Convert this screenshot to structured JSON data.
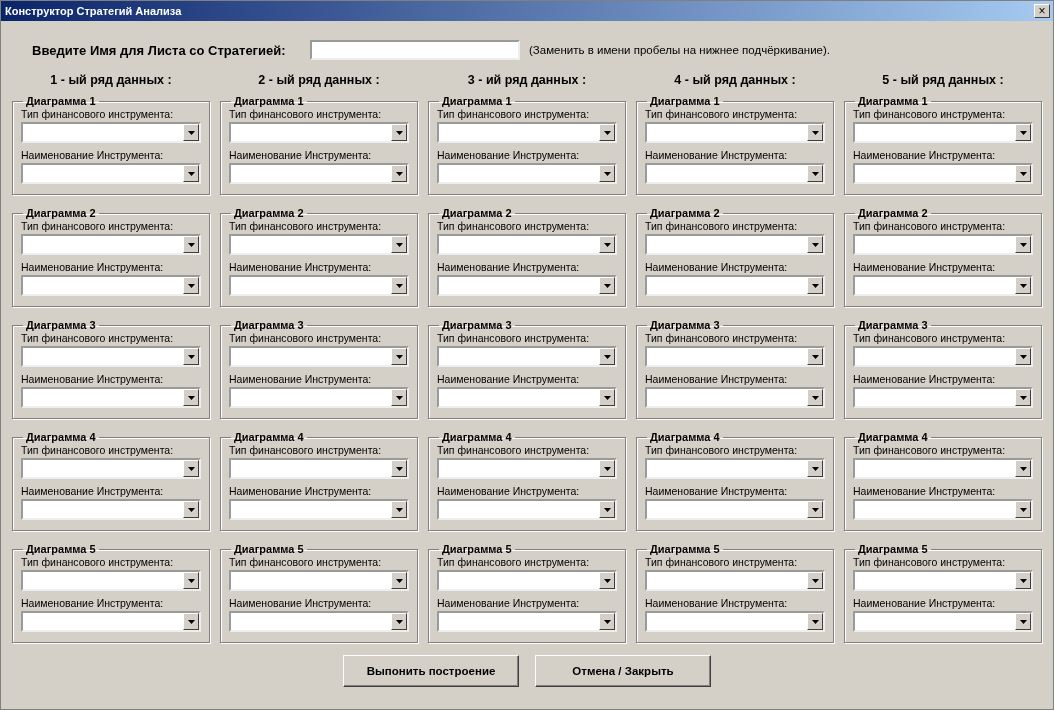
{
  "window": {
    "title": "Конструктор Стратегий Анализа",
    "close": "×"
  },
  "sheet_name": {
    "label": "Введите Имя для Листа со Стратегией:",
    "hint": "(Заменить в имени пробелы на нижнее подчёркивание)."
  },
  "series": [
    {
      "header": "1 - ый ряд данных :",
      "diagrams": [
        {
          "title": "Диаграмма 1",
          "type_label": "Тип финансового инструмента:",
          "name_label": "Наименование Инструмента:"
        },
        {
          "title": "Диаграмма 2",
          "type_label": "Тип финансового инструмента:",
          "name_label": "Наименование Инструмента:"
        },
        {
          "title": "Диаграмма 3",
          "type_label": "Тип финансового инструмента:",
          "name_label": "Наименование Инструмента:"
        },
        {
          "title": "Диаграмма 4",
          "type_label": "Тип финансового инструмента:",
          "name_label": "Наименование Инструмента:"
        },
        {
          "title": "Диаграмма 5",
          "type_label": "Тип финансового инструмента:",
          "name_label": "Наименование Инструмента:"
        }
      ]
    },
    {
      "header": "2 - ый ряд данных :",
      "diagrams": [
        {
          "title": "Диаграмма 1",
          "type_label": "Тип финансового инструмента:",
          "name_label": "Наименование Инструмента:"
        },
        {
          "title": "Диаграмма 2",
          "type_label": "Тип финансового инструмента:",
          "name_label": "Наименование Инструмента:"
        },
        {
          "title": "Диаграмма 3",
          "type_label": "Тип финансового инструмента:",
          "name_label": "Наименование Инструмента:"
        },
        {
          "title": "Диаграмма 4",
          "type_label": "Тип финансового инструмента:",
          "name_label": "Наименование Инструмента:"
        },
        {
          "title": "Диаграмма 5",
          "type_label": "Тип финансового инструмента:",
          "name_label": "Наименование Инструмента:"
        }
      ]
    },
    {
      "header": "3 - ий ряд данных :",
      "diagrams": [
        {
          "title": "Диаграмма 1",
          "type_label": "Тип финансового инструмента:",
          "name_label": "Наименование Инструмента:"
        },
        {
          "title": "Диаграмма 2",
          "type_label": "Тип финансового инструмента:",
          "name_label": "Наименование Инструмента:"
        },
        {
          "title": "Диаграмма 3",
          "type_label": "Тип финансового инструмента:",
          "name_label": "Наименование Инструмента:"
        },
        {
          "title": "Диаграмма 4",
          "type_label": "Тип финансового инструмента:",
          "name_label": "Наименование Инструмента:"
        },
        {
          "title": "Диаграмма 5",
          "type_label": "Тип финансового инструмента:",
          "name_label": "Наименование Инструмента:"
        }
      ]
    },
    {
      "header": "4 - ый ряд данных :",
      "diagrams": [
        {
          "title": "Диаграмма 1",
          "type_label": "Тип финансового инструмента:",
          "name_label": "Наименование Инструмента:"
        },
        {
          "title": "Диаграмма 2",
          "type_label": "Тип финансового инструмента:",
          "name_label": "Наименование Инструмента:"
        },
        {
          "title": "Диаграмма 3",
          "type_label": "Тип финансового инструмента:",
          "name_label": "Наименование Инструмента:"
        },
        {
          "title": "Диаграмма 4",
          "type_label": "Тип финансового инструмента:",
          "name_label": "Наименование Инструмента:"
        },
        {
          "title": "Диаграмма 5",
          "type_label": "Тип финансового инструмента:",
          "name_label": "Наименование Инструмента:"
        }
      ]
    },
    {
      "header": "5 - ый ряд данных :",
      "diagrams": [
        {
          "title": "Диаграмма 1",
          "type_label": "Тип финансового инструмента:",
          "name_label": "Наименование Инструмента:"
        },
        {
          "title": "Диаграмма 2",
          "type_label": "Тип финансового инструмента:",
          "name_label": "Наименование Инструмента:"
        },
        {
          "title": "Диаграмма 3",
          "type_label": "Тип финансового инструмента:",
          "name_label": "Наименование Инструмента:"
        },
        {
          "title": "Диаграмма 4",
          "type_label": "Тип финансового инструмента:",
          "name_label": "Наименование Инструмента:"
        },
        {
          "title": "Диаграмма 5",
          "type_label": "Тип финансового инструмента:",
          "name_label": "Наименование Инструмента:"
        }
      ]
    }
  ],
  "buttons": [
    "Выпонить построение",
    "Отмена / Закрыть"
  ]
}
